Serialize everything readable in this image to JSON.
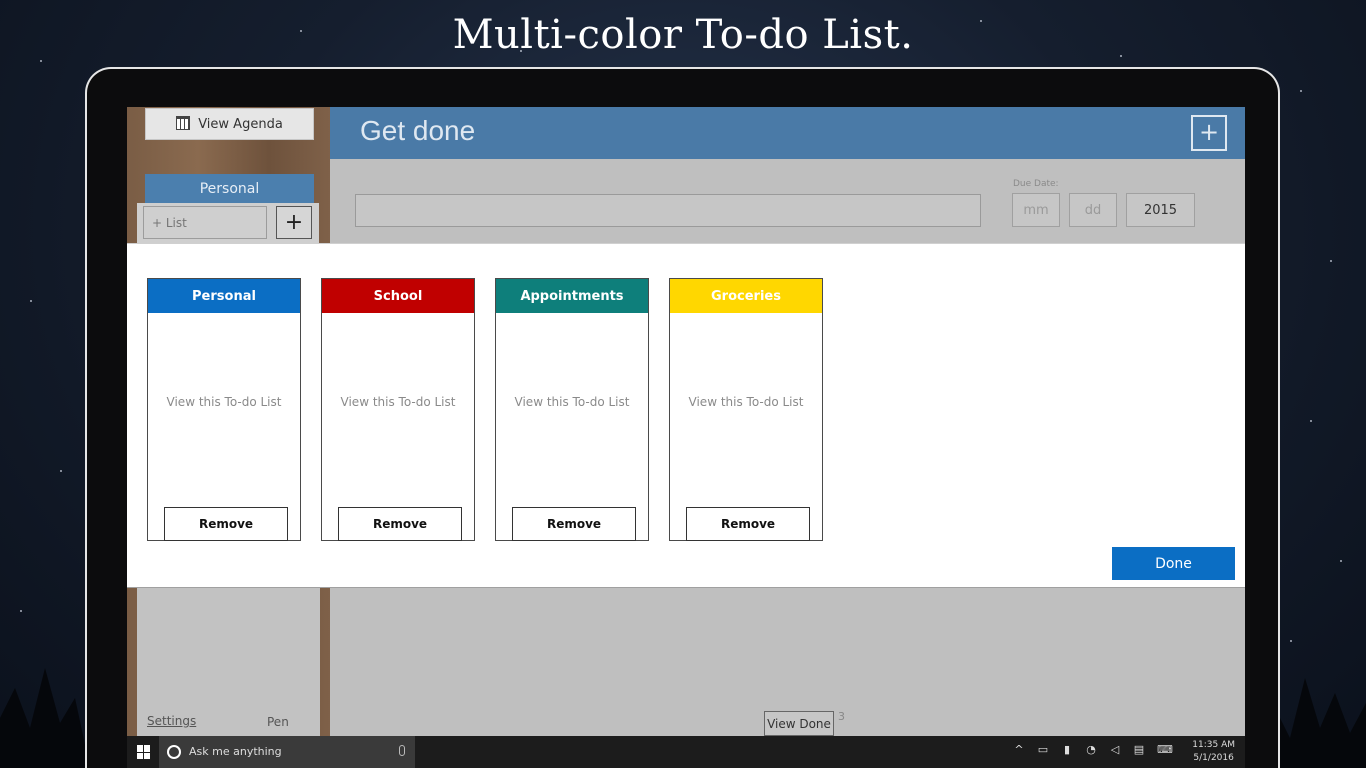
{
  "headline": "Multi-color To-do List.",
  "sidebar": {
    "view_agenda_label": "View Agenda",
    "active_list": "Personal",
    "new_list_placeholder": "+ List",
    "add_list_symbol": "+",
    "settings_label": "Settings",
    "pen_label": "Pen"
  },
  "header": {
    "title": "Get done",
    "add_symbol": "+"
  },
  "task_entry": {
    "value": "",
    "due_date_label": "Due Date:",
    "month_placeholder": "mm",
    "day_placeholder": "dd",
    "year_value": "2015"
  },
  "lists_dialog": {
    "cards": [
      {
        "name": "Personal",
        "color": "#0b6ec4",
        "view_label": "View this To-do List",
        "remove_label": "Remove"
      },
      {
        "name": "School",
        "color": "#c00000",
        "view_label": "View this To-do List",
        "remove_label": "Remove"
      },
      {
        "name": "Appointments",
        "color": "#0e7f7b",
        "view_label": "View this To-do List",
        "remove_label": "Remove"
      },
      {
        "name": "Groceries",
        "color": "#ffd700",
        "view_label": "View this To-do List",
        "remove_label": "Remove"
      }
    ],
    "done_label": "Done"
  },
  "footer": {
    "view_done_label": "View Done",
    "done_count": "3"
  },
  "taskbar": {
    "search_placeholder": "Ask me anything",
    "time": "11:35 AM",
    "date": "5/1/2016"
  },
  "colors": {
    "header_blue": "#4a7aa7",
    "done_button_blue": "#0b6ec4",
    "wood_brown": "#7a5d45"
  }
}
